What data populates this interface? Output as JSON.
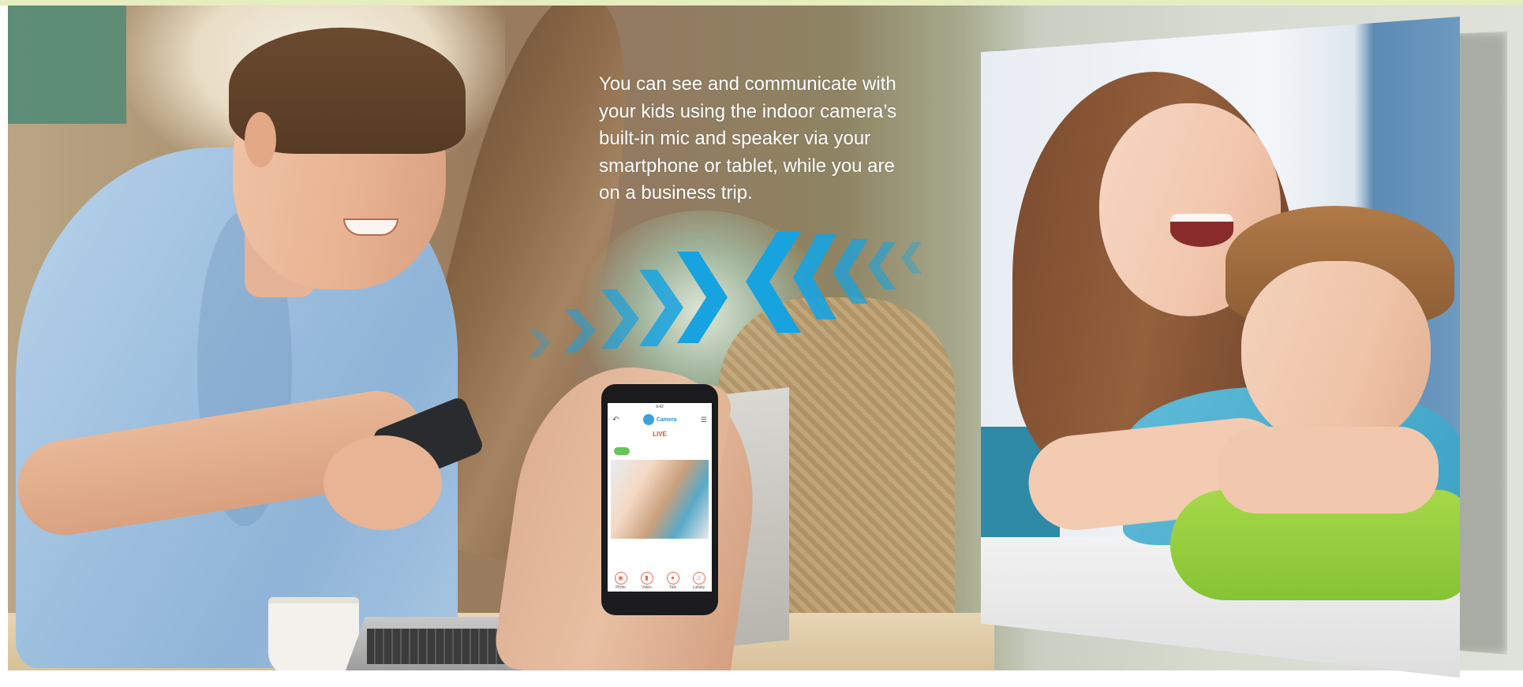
{
  "banner": {
    "description": "You can see and communicate with your kids using the indoor camera’s built-in mic and speaker via your smartphone or tablet, while you are on a business trip."
  },
  "phone_app": {
    "status_time": "9:42",
    "app_name": "Camera",
    "live_label": "LIVE",
    "buttons": [
      {
        "label": "Photo",
        "icon": "camera-icon"
      },
      {
        "label": "Video",
        "icon": "video-icon"
      },
      {
        "label": "Talk",
        "icon": "microphone-icon"
      },
      {
        "label": "Lullaby",
        "icon": "music-note-icon"
      }
    ]
  },
  "colors": {
    "chevron_blue": "#17a3e0",
    "accent_orange": "#e9694a",
    "live_red": "#e44d2e",
    "top_strip": "#e6edbf"
  }
}
